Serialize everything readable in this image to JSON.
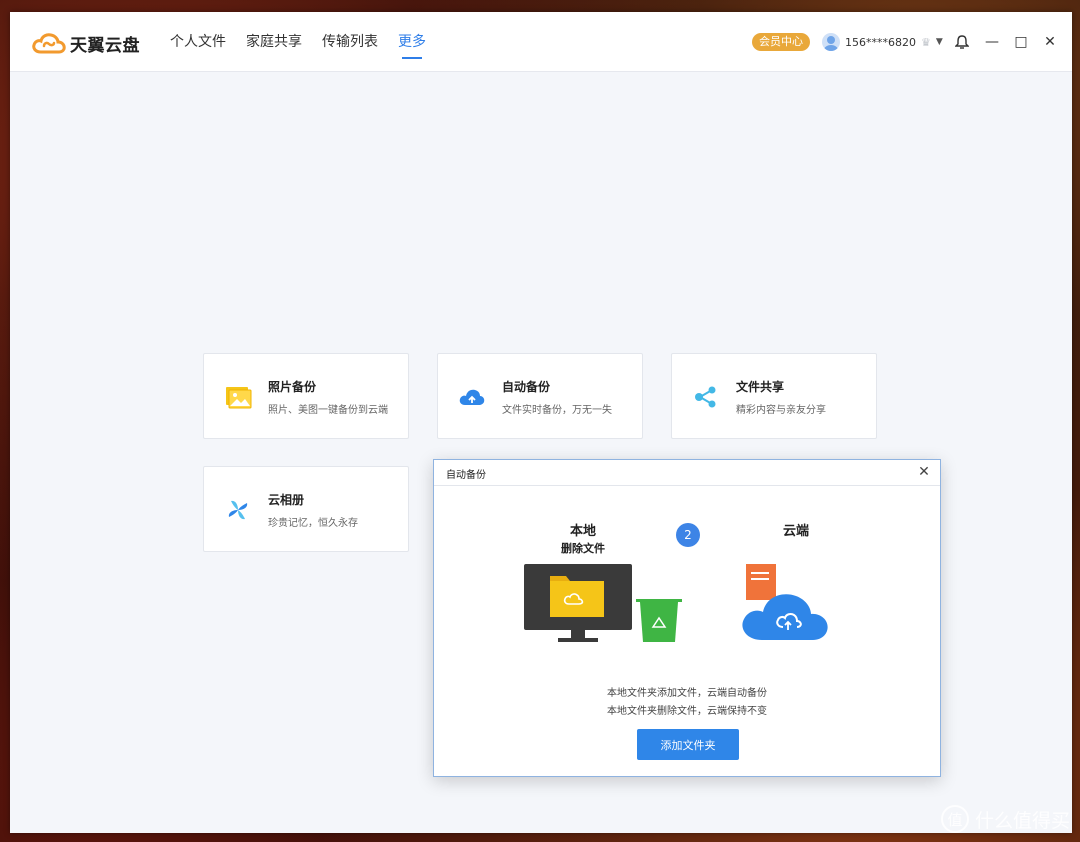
{
  "app": {
    "name": "天翼云盘"
  },
  "nav": [
    {
      "label": "个人文件"
    },
    {
      "label": "家庭共享"
    },
    {
      "label": "传输列表"
    },
    {
      "label": "更多"
    }
  ],
  "header": {
    "vip_label": "会员中心",
    "username": "156****6820",
    "crown_glyph": "♛",
    "caret_glyph": "▼"
  },
  "window_controls": {
    "notification_glyph": "🔔",
    "minimize_glyph": "—",
    "maximize_glyph": "□",
    "close_glyph": "✕"
  },
  "features": [
    {
      "title": "照片备份",
      "desc": "照片、美图一键备份到云端",
      "icon": "photo-icon"
    },
    {
      "title": "自动备份",
      "desc": "文件实时备份，万无一失",
      "icon": "cloud-upload-icon"
    },
    {
      "title": "文件共享",
      "desc": "精彩内容与亲友分享",
      "icon": "share-icon"
    },
    {
      "title": "云相册",
      "desc": "珍贵记忆，恒久永存",
      "icon": "pinwheel-icon"
    }
  ],
  "dialog": {
    "title": "自动备份",
    "close_glyph": "✕",
    "local_title": "本地",
    "local_subtitle": "删除文件",
    "step": "2",
    "cloud_title": "云端",
    "info": [
      "本地文件夹添加文件，云端自动备份",
      "本地文件夹删除文件，云端保持不变"
    ],
    "button_label": "添加文件夹"
  },
  "watermark": {
    "glyph": "值",
    "text": "什么值得买"
  },
  "colors": {
    "accent": "#2f7ee8",
    "vip": "#e9a83a",
    "button": "#2f86e8",
    "logo_orange": "#f29a2e"
  }
}
